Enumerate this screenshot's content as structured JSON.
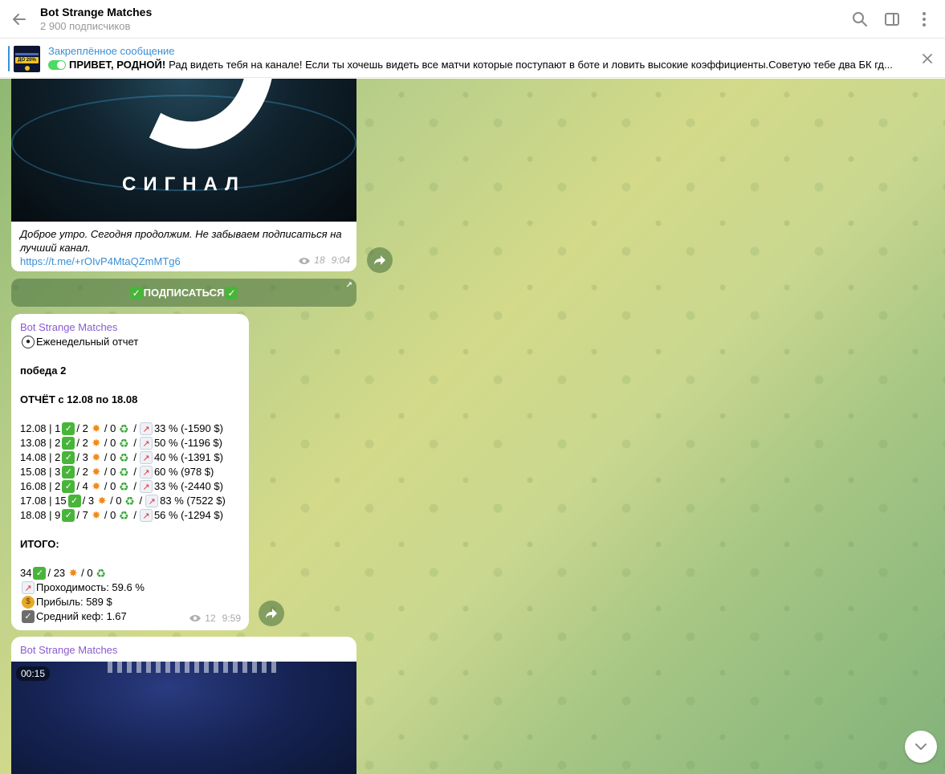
{
  "header": {
    "title": "Bot Strange Matches",
    "subtitle": "2 900 подписчиков"
  },
  "pinned": {
    "label": "Закреплённое сообщение",
    "bold_text": "ПРИВЕТ, РОДНОЙ!",
    "text": "Рад видеть тебя на канале! Если ты хочешь видеть все матчи которые поступают в боте и ловить высокие коэффициенты.Советую тебе два БК гд...",
    "thumb_text": "ДО 20%"
  },
  "message1": {
    "image_word": "СИГНАЛ",
    "caption": "Доброе утро. Сегодня продолжим. Не забываем подписаться на лучший канал.",
    "link": "https://t.me/+rOIvP4MtaQZmMTg6",
    "views": "18",
    "time": "9:04",
    "button_label": "ПОДПИСАТЬСЯ"
  },
  "message2": {
    "sender": "Bot Strange Matches",
    "weekly": "Еженедельный отчет",
    "line_win": "победа 2",
    "report_title": "ОТЧЁТ с 12.08 по 18.08",
    "rows": [
      {
        "a": "12.08 | 1",
        "b": "/ 2",
        "c": "/ 0",
        "d": "33 % (-1590 $)"
      },
      {
        "a": "13.08 | 2",
        "b": "/ 2",
        "c": "/ 0",
        "d": "50 % (-1196 $)"
      },
      {
        "a": "14.08 | 2",
        "b": "/ 3",
        "c": "/ 0",
        "d": "40 % (-1391 $)"
      },
      {
        "a": "15.08 | 3",
        "b": "/ 2",
        "c": "/ 0",
        "d": "60 % (978 $)"
      },
      {
        "a": "16.08 | 2",
        "b": "/ 4",
        "c": "/ 0",
        "d": "33 % (-2440 $)"
      },
      {
        "a": "17.08 | 15",
        "b": "/ 3",
        "c": "/ 0",
        "d": "83 % (7522 $)"
      },
      {
        "a": "18.08 | 9",
        "b": "/ 7",
        "c": "/ 0",
        "d": "56 % (-1294 $)"
      }
    ],
    "total_label": "ИТОГО:",
    "total_a": "34",
    "total_b": "/ 23",
    "total_c": "/ 0",
    "passrate": "Проходимость: 59.6 %",
    "profit": "Прибыль: 589 $",
    "avg": "Средний кеф: 1.67",
    "views": "12",
    "time": "9:59"
  },
  "message3": {
    "sender": "Bot Strange Matches",
    "duration": "00:15"
  },
  "colors": {
    "accent": "#3a8fd6",
    "sender": "#8a5bd0",
    "check": "#48b53a"
  }
}
